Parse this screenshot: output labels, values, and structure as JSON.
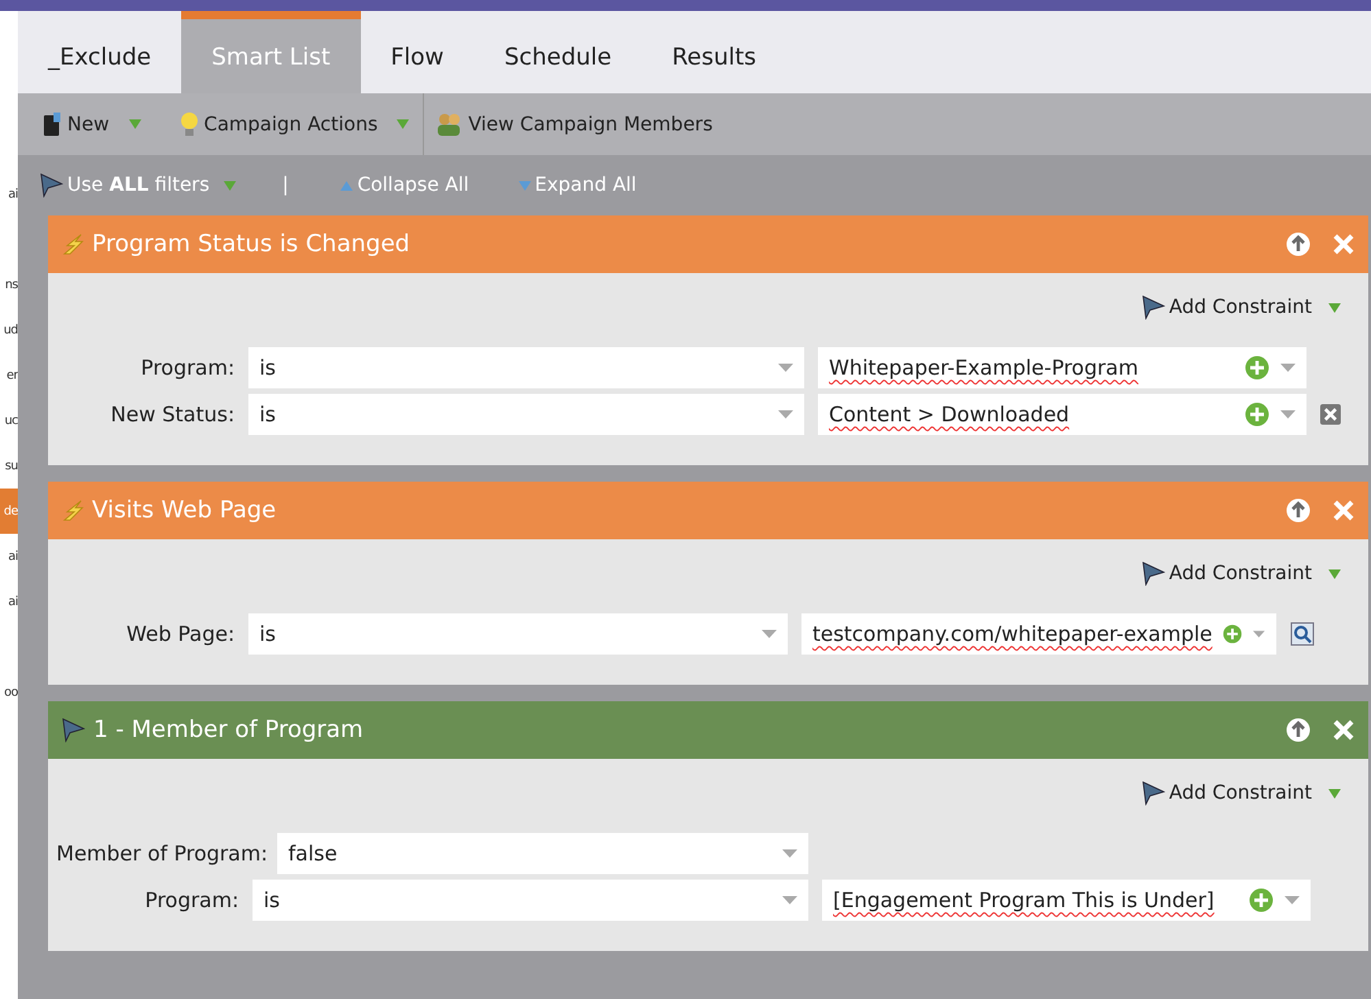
{
  "sidebar": {
    "items": [
      {
        "label": "ai",
        "selected": false
      },
      {
        "selected": false
      },
      {
        "label": "ns",
        "selected": false
      },
      {
        "label": "ud",
        "selected": false
      },
      {
        "label": "er",
        "selected": false
      },
      {
        "label": "uc",
        "selected": false
      },
      {
        "label": "su",
        "selected": false
      },
      {
        "label": "de",
        "selected": true
      },
      {
        "label": "ai",
        "selected": false
      },
      {
        "label": "ai",
        "selected": false
      },
      {
        "selected": false
      },
      {
        "label": "oo",
        "selected": false
      }
    ]
  },
  "tabs": [
    {
      "label": "_Exclude",
      "selected": false
    },
    {
      "label": "Smart List",
      "selected": true
    },
    {
      "label": "Flow",
      "selected": false
    },
    {
      "label": "Schedule",
      "selected": false
    },
    {
      "label": "Results",
      "selected": false
    }
  ],
  "toolbar": [
    {
      "label": "New",
      "kind": "new",
      "dropdown": true
    },
    {
      "label": "Campaign Actions",
      "kind": "actions",
      "dropdown": true
    },
    {
      "label": "View Campaign Members",
      "kind": "members",
      "dropdown": false
    }
  ],
  "filter_bar": {
    "rule": "Use **ALL** filters",
    "separator": "|",
    "collapse": "Collapse All",
    "expand": "Expand All"
  },
  "filters": [
    {
      "kind": "trigger",
      "title": "Program Status is Changed",
      "add_constraint": "Add Constraint",
      "rows": [
        {
          "label": "Program:",
          "operator": "is",
          "value": "Whitepaper-Example-Program",
          "delete": false,
          "lookup": false
        },
        {
          "label": "New Status:",
          "operator": "is",
          "value": "Content > Downloaded",
          "delete": true,
          "lookup": false
        }
      ]
    },
    {
      "kind": "trigger",
      "title": "Visits Web Page",
      "add_constraint": "Add Constraint",
      "rows": [
        {
          "label": "Web Page:",
          "operator": "is",
          "value": "testcompany.com/whitepaper-example",
          "delete": false,
          "lookup": true
        }
      ]
    },
    {
      "kind": "filter",
      "title": "1 - Member of Program",
      "add_constraint": "Add Constraint",
      "rows": [
        {
          "label": "Member of Program:",
          "operator": "false",
          "delete": false,
          "lookup": false
        },
        {
          "label": "Program:",
          "operator": "is",
          "value": "[Engagement Program This is Under]",
          "delete": false,
          "lookup": false
        }
      ]
    }
  ]
}
